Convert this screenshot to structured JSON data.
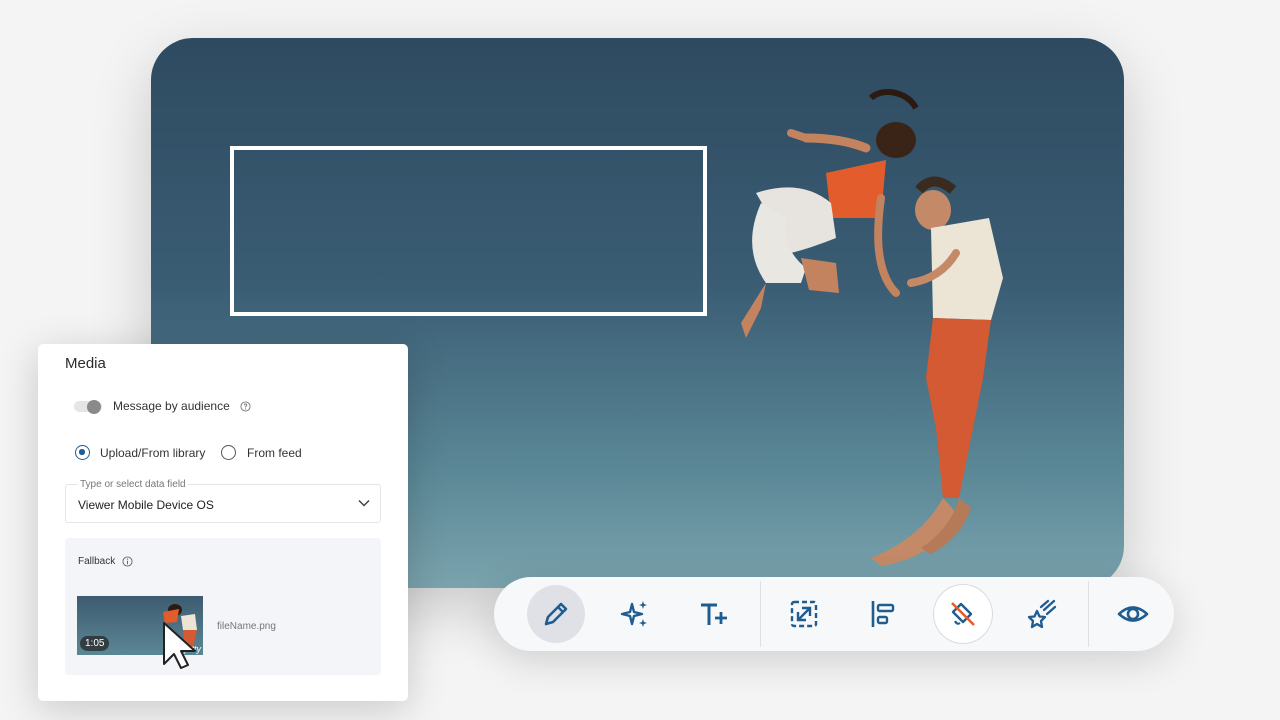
{
  "panel": {
    "title": "Media",
    "toggle_label": "Message by audience",
    "radio_upload": "Upload/From library",
    "radio_feed": "From feed",
    "select_hint": "Type or select data field",
    "select_value": "Viewer Mobile Device OS",
    "fallback_label": "Fallback",
    "thumb_duration": "1:05",
    "thumb_watermark": "getty",
    "file_name": "fileName.png"
  },
  "toolbar": {
    "tools": [
      "pencil-icon",
      "sparkles-icon",
      "text-plus-icon",
      "resize-icon",
      "align-left-icon",
      "no-style-icon",
      "shooting-star-icon",
      "eye-icon"
    ],
    "active_tool": "pencil-icon"
  },
  "colors": {
    "accent": "#1f5d91",
    "orange": "#e35d2c",
    "sky_top": "#2e4a60",
    "sky_bottom": "#7aa3ad"
  }
}
